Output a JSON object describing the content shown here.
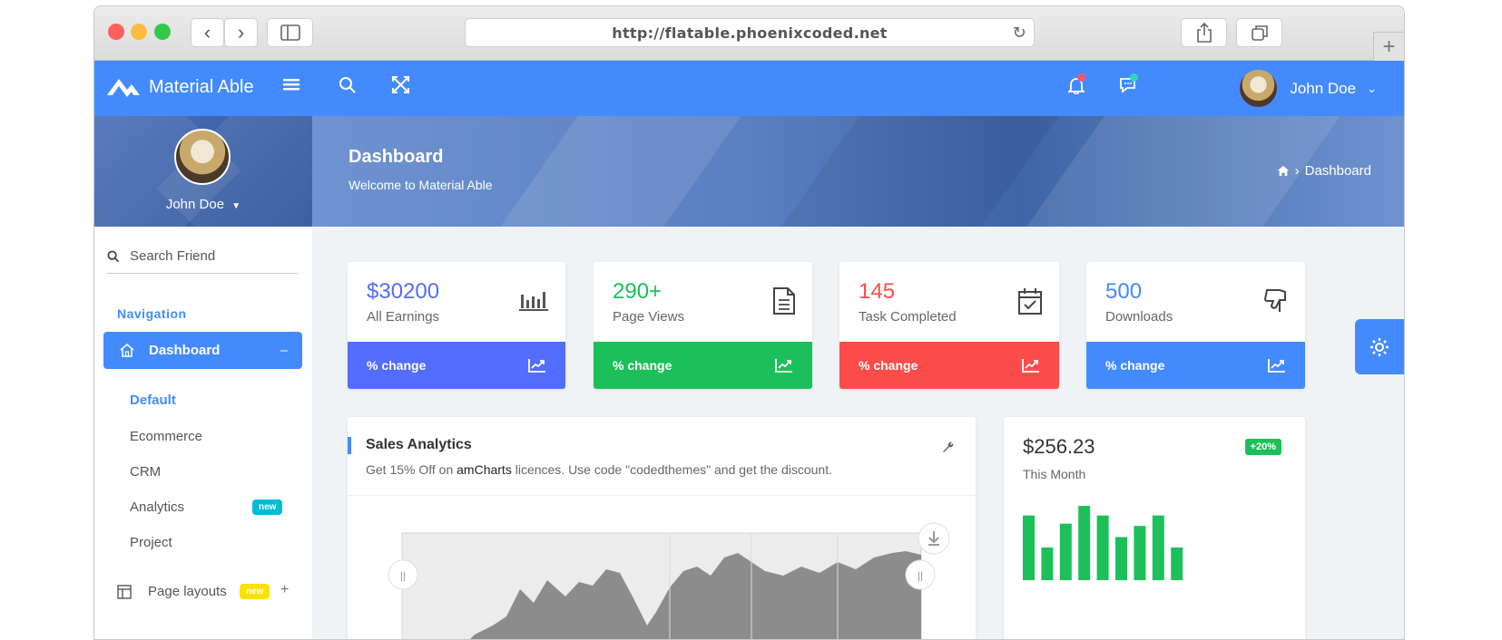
{
  "browser": {
    "url": "http://flatable.phoenixcoded.net"
  },
  "topbar": {
    "brand": "Material Able",
    "user_name": "John Doe"
  },
  "sidebar": {
    "user_name": "John Doe",
    "search_placeholder": "Search Friend",
    "nav_title": "Navigation",
    "active_item": "Dashboard",
    "active_item_toggle": "–",
    "sub_items": [
      {
        "label": "Default",
        "active": true
      },
      {
        "label": "Ecommerce"
      },
      {
        "label": "CRM"
      },
      {
        "label": "Analytics",
        "badge": "new"
      },
      {
        "label": "Project"
      }
    ],
    "next_item": {
      "label": "Page layouts",
      "badge": "new",
      "toggle": "+"
    }
  },
  "header": {
    "title": "Dashboard",
    "subtitle": "Welcome to Material Able",
    "breadcrumb": "Dashboard",
    "breadcrumb_sep": "›"
  },
  "stats": [
    {
      "value": "$30200",
      "label": "All Earnings",
      "footer": "% change",
      "color": "#536dfe",
      "icon": "bar-chart-icon"
    },
    {
      "value": "290+",
      "label": "Page Views",
      "footer": "% change",
      "color": "#1cc05a",
      "icon": "document-icon"
    },
    {
      "value": "145",
      "label": "Task Completed",
      "footer": "% change",
      "color": "#fc4b4b",
      "icon": "calendar-check-icon"
    },
    {
      "value": "500",
      "label": "Downloads",
      "footer": "% change",
      "color": "#448aff",
      "icon": "thumbs-down-icon"
    }
  ],
  "sales": {
    "title": "Sales Analytics",
    "desc_before": "Get 15% Off on ",
    "desc_link": "amCharts",
    "desc_after": " licences. Use code \"codedthemes\" and get the discount."
  },
  "month_card": {
    "value": "$256.23",
    "badge": "+20%",
    "label": "This Month",
    "bar_color": "#1cc05a",
    "bars": [
      0.87,
      0.44,
      0.76,
      1.0,
      0.87,
      0.58,
      0.73,
      0.87,
      0.44
    ]
  },
  "colors": {
    "primary": "#448aff",
    "green": "#1cc05a",
    "red": "#fc4b4b",
    "indigo": "#536dfe",
    "teal_badge": "#00bcd4",
    "yellow_badge": "#ffe100"
  }
}
